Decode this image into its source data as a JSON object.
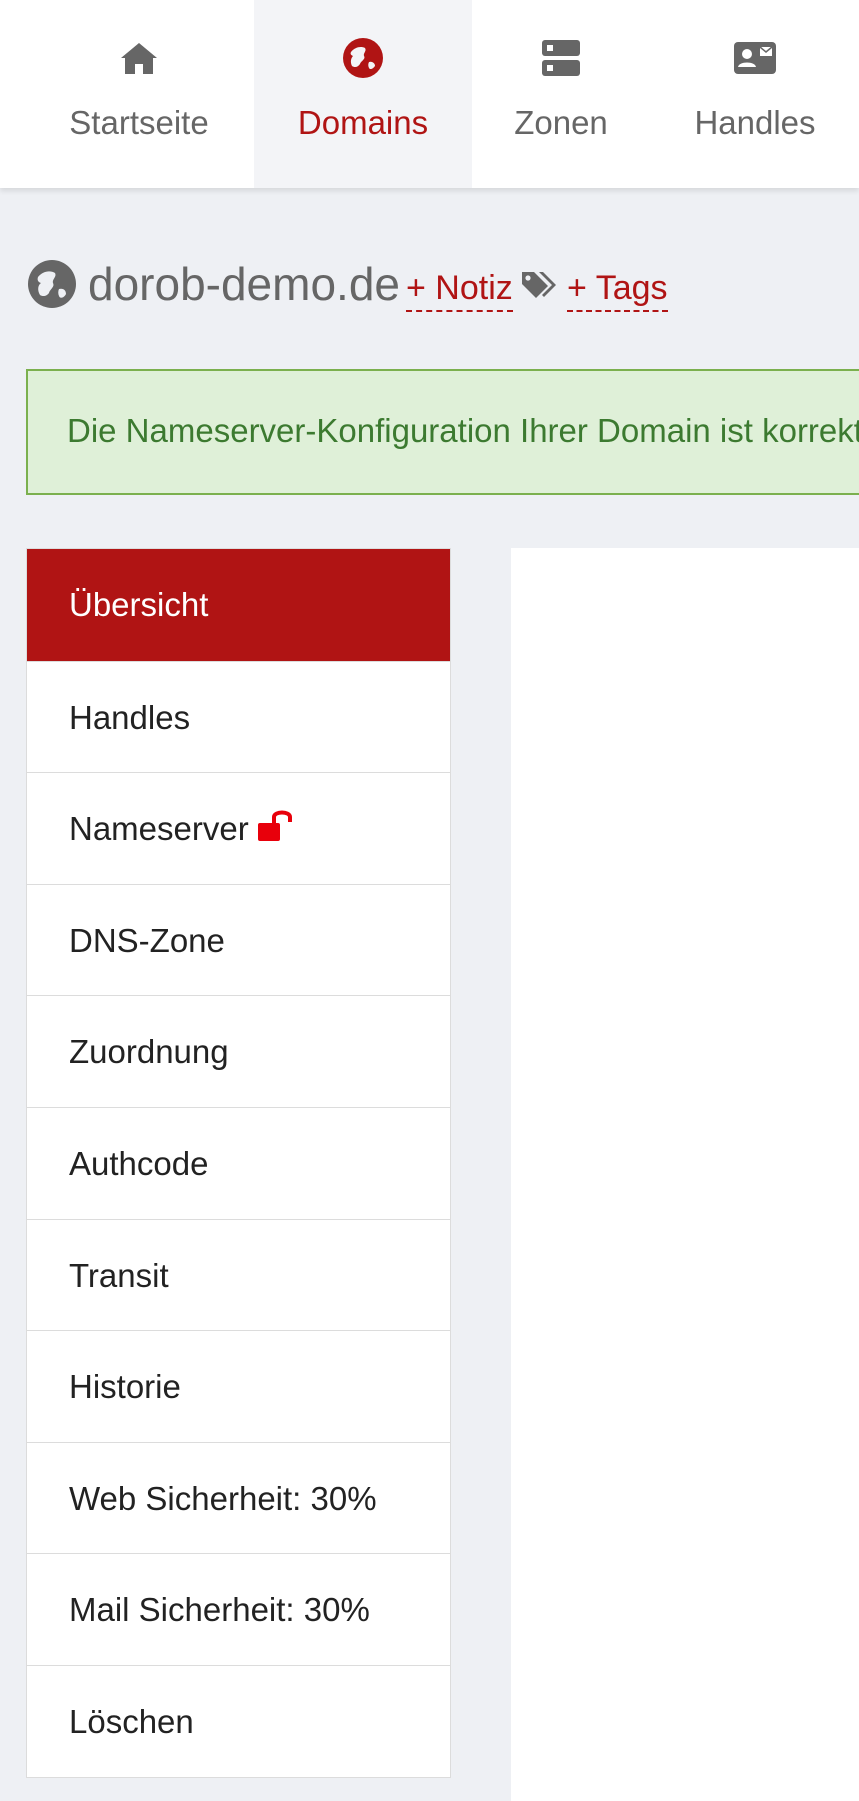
{
  "nav": {
    "items": [
      {
        "label": "Startseite",
        "icon": "home-icon",
        "active": false
      },
      {
        "label": "Domains",
        "icon": "globe-icon",
        "active": true
      },
      {
        "label": "Zonen",
        "icon": "server-icon",
        "active": false
      },
      {
        "label": "Handles",
        "icon": "contact-card-icon",
        "active": false
      }
    ]
  },
  "header": {
    "domain": "dorob-demo.de",
    "note_link": "+ Notiz",
    "tags_link": "+ Tags"
  },
  "alert": {
    "text": "Die Nameserver-Konfiguration Ihrer Domain ist korrekt."
  },
  "sidebar": {
    "items": [
      {
        "label": "Übersicht",
        "active": true
      },
      {
        "label": "Handles",
        "active": false
      },
      {
        "label": "Nameserver",
        "active": false,
        "icon": "unlock-icon"
      },
      {
        "label": "DNS-Zone",
        "active": false
      },
      {
        "label": "Zuordnung",
        "active": false
      },
      {
        "label": "Authcode",
        "active": false
      },
      {
        "label": "Transit",
        "active": false
      },
      {
        "label": "Historie",
        "active": false
      },
      {
        "label": "Web Sicherheit: 30%",
        "active": false
      },
      {
        "label": "Mail Sicherheit: 30%",
        "active": false
      },
      {
        "label": "Löschen",
        "active": false
      }
    ]
  },
  "colors": {
    "accent": "#b01414",
    "nav_text": "#666666",
    "alert_bg": "#dff0d8",
    "alert_border": "#7bb04e",
    "alert_text": "#3c7a30",
    "page_bg": "#eef0f4",
    "lock_red": "#e8000b"
  }
}
